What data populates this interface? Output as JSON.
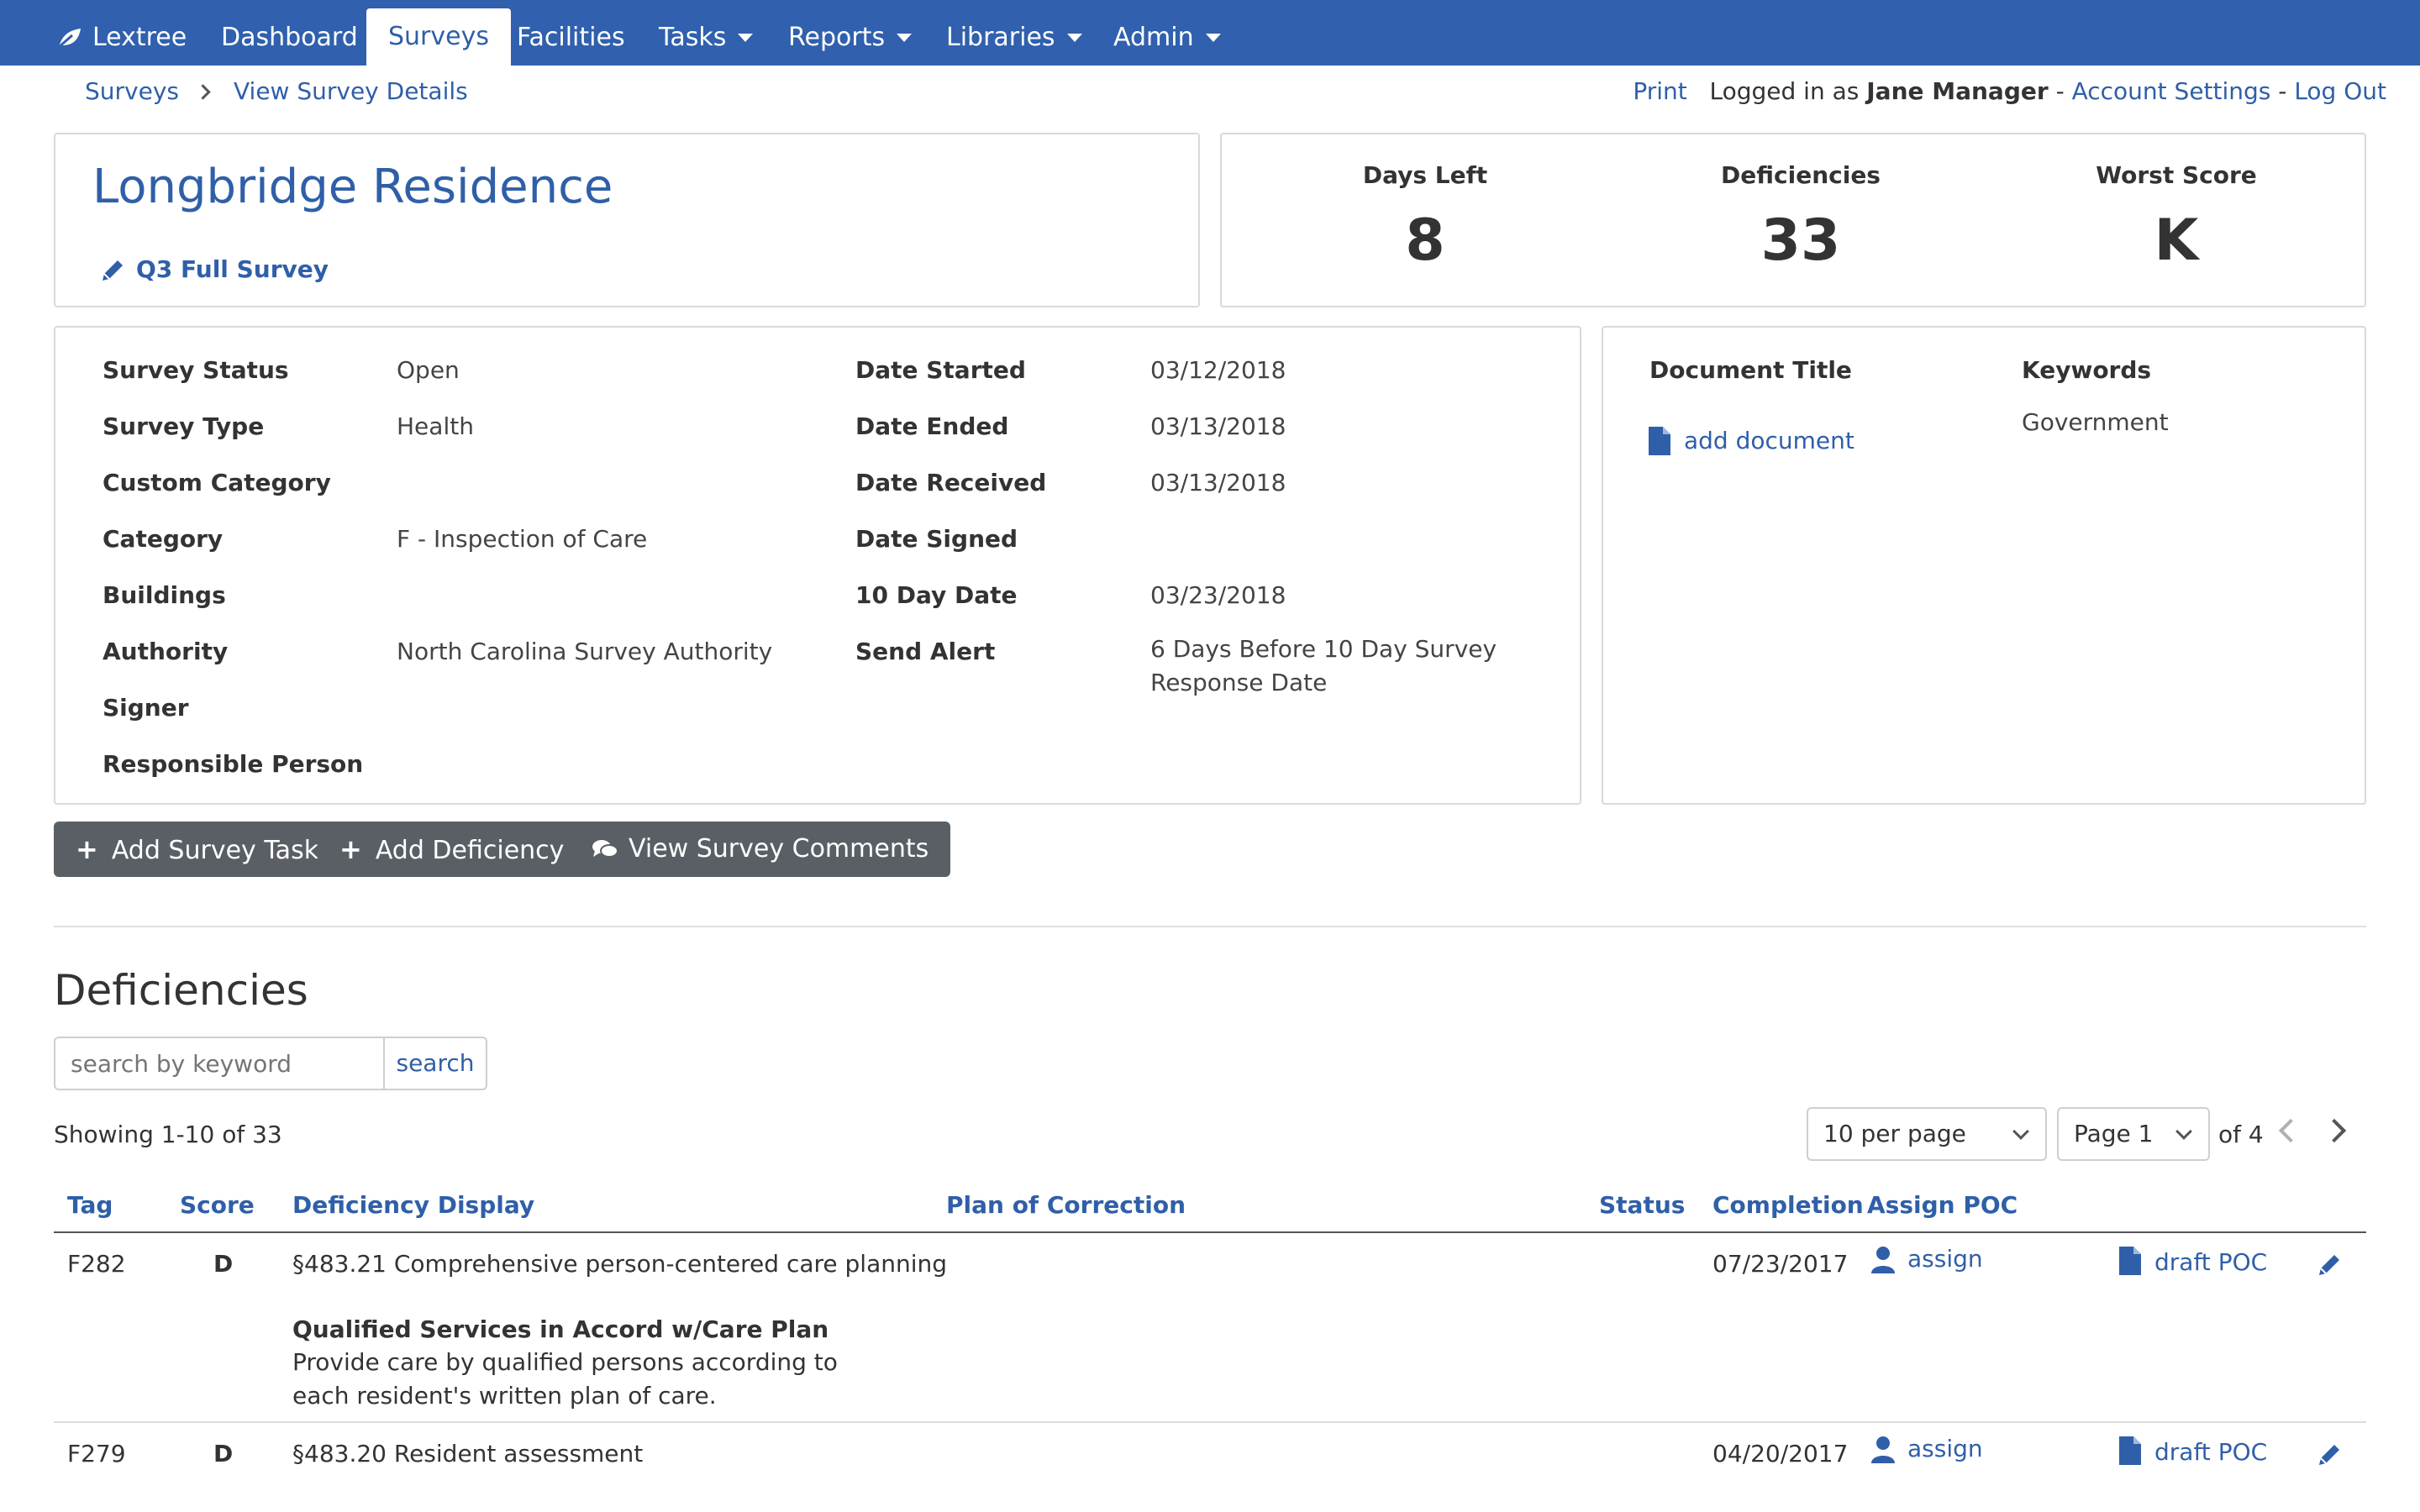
{
  "nav": {
    "brand": "Lextree",
    "items": [
      {
        "label": "Dashboard"
      },
      {
        "label": "Surveys"
      },
      {
        "label": "Facilities"
      },
      {
        "label": "Tasks"
      },
      {
        "label": "Reports"
      },
      {
        "label": "Libraries"
      },
      {
        "label": "Admin"
      }
    ]
  },
  "breadcrumb": {
    "items": [
      "Surveys",
      "View Survey Details"
    ]
  },
  "topbar": {
    "print": "Print",
    "logged_in_prefix": "Logged in as",
    "user": "Jane Manager",
    "sep": "-",
    "account_settings": "Account Settings",
    "logout": "Log Out"
  },
  "header": {
    "facility": "Longbridge Residence",
    "survey_name": "Q3 Full Survey"
  },
  "stats": [
    {
      "label": "Days Left",
      "value": "8"
    },
    {
      "label": "Deficiencies",
      "value": "33"
    },
    {
      "label": "Worst Score",
      "value": "K"
    }
  ],
  "details_left": [
    {
      "label": "Survey Status",
      "value": "Open"
    },
    {
      "label": "Survey Type",
      "value": "Health"
    },
    {
      "label": "Custom Category",
      "value": ""
    },
    {
      "label": "Category",
      "value": "F - Inspection of Care"
    },
    {
      "label": "Buildings",
      "value": ""
    },
    {
      "label": "Authority",
      "value": "North Carolina Survey Authority"
    },
    {
      "label": "Signer",
      "value": ""
    },
    {
      "label": "Responsible Person",
      "value": ""
    }
  ],
  "details_right": [
    {
      "label": "Date Started",
      "value": "03/12/2018"
    },
    {
      "label": "Date Ended",
      "value": "03/13/2018"
    },
    {
      "label": "Date Received",
      "value": "03/13/2018"
    },
    {
      "label": "Date Signed",
      "value": ""
    },
    {
      "label": "10 Day Date",
      "value": "03/23/2018"
    },
    {
      "label": "Send Alert",
      "value": "6 Days Before 10 Day Survey Response Date"
    }
  ],
  "documents": {
    "title_header": "Document Title",
    "keywords_header": "Keywords",
    "add_label": "add document",
    "keyword": "Government"
  },
  "actions": {
    "add_task": "Add Survey Task",
    "add_deficiency": "Add Deficiency",
    "view_comments": "View Survey Comments"
  },
  "deficiencies": {
    "title": "Deficiencies",
    "search_placeholder": "search by keyword",
    "search_button": "search",
    "showing": "Showing 1-10 of 33",
    "per_page": "10 per page",
    "page": "Page 1",
    "of_pages": "of 4",
    "columns": [
      "Tag",
      "Score",
      "Deficiency Display",
      "Plan of Correction",
      "Status",
      "Completion",
      "Assign POC"
    ],
    "rows": [
      {
        "tag": "F282",
        "score": "D",
        "regulation": "§483.21 Comprehensive person-centered care planning",
        "heading": "Qualified Services in Accord w/Care Plan",
        "description": "Provide care by qualified persons according to each resident's written plan of care.",
        "completion": "07/23/2017",
        "assign": "assign",
        "draft": "draft POC"
      },
      {
        "tag": "F279",
        "score": "D",
        "regulation": "§483.20 Resident assessment",
        "completion": "04/20/2017",
        "assign": "assign",
        "draft": "draft POC"
      }
    ]
  },
  "colors": {
    "nav": "#3060ae",
    "link": "#2f5fa8",
    "button": "#5a5f66"
  }
}
